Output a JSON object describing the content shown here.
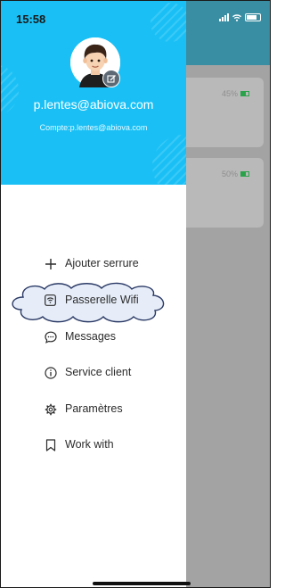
{
  "status_bar": {
    "time": "15:58"
  },
  "background_page": {
    "devices": [
      {
        "battery": "45%"
      },
      {
        "battery": "50%"
      }
    ]
  },
  "drawer": {
    "email": "p.lentes@abiova.com",
    "account": "Compte:p.lentes@abiova.com",
    "menu": [
      {
        "label": "Ajouter serrure",
        "icon": "plus-icon"
      },
      {
        "label": "Passerelle Wifi",
        "icon": "wifi-gateway-icon"
      },
      {
        "label": "Messages",
        "icon": "message-icon"
      },
      {
        "label": "Service client",
        "icon": "info-icon"
      },
      {
        "label": "Paramètres",
        "icon": "settings-icon"
      },
      {
        "label": "Work with",
        "icon": "bookmark-icon"
      }
    ]
  },
  "colors": {
    "drawer_header": "#1ac0f5",
    "app_header": "#3a8ea3",
    "overlay": "#a3a3a3",
    "highlight_fill": "#e6edf8",
    "highlight_stroke": "#2b3a66",
    "battery_green": "#2aa24a"
  }
}
